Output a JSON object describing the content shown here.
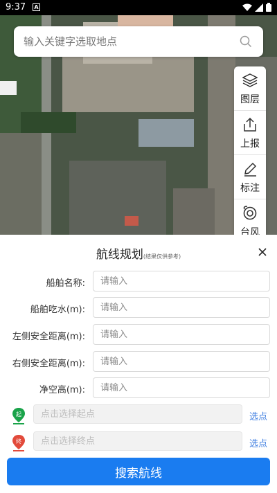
{
  "status": {
    "time": "9:37",
    "notif_letter": "A"
  },
  "search": {
    "placeholder": "输入关键字选取地点"
  },
  "tools": [
    {
      "label": "图层",
      "icon": "layers-icon"
    },
    {
      "label": "上报",
      "icon": "upload-icon"
    },
    {
      "label": "标注",
      "icon": "pencil-icon"
    },
    {
      "label": "台风",
      "icon": "typhoon-icon"
    }
  ],
  "panel": {
    "title": "航线规划",
    "subtitle": "(结果仅供参考)",
    "fields": [
      {
        "label": "船舶名称:",
        "placeholder": "请输入"
      },
      {
        "label": "船舶吃水(m):",
        "placeholder": "请输入"
      },
      {
        "label": "左侧安全距离(m):",
        "placeholder": "请输入"
      },
      {
        "label": "右侧安全距离(m):",
        "placeholder": "请输入"
      },
      {
        "label": "净空高(m):",
        "placeholder": "请输入"
      }
    ],
    "start": {
      "badge": "起",
      "placeholder": "点击选择起点",
      "pick": "选点"
    },
    "end": {
      "badge": "终",
      "placeholder": "点击选择终点",
      "pick": "选点"
    },
    "submit": "搜索航线"
  },
  "colors": {
    "accent": "#1a7cf0",
    "link": "#3a7be0",
    "start_pin": "#1aa34a",
    "end_pin": "#e24a3b"
  }
}
